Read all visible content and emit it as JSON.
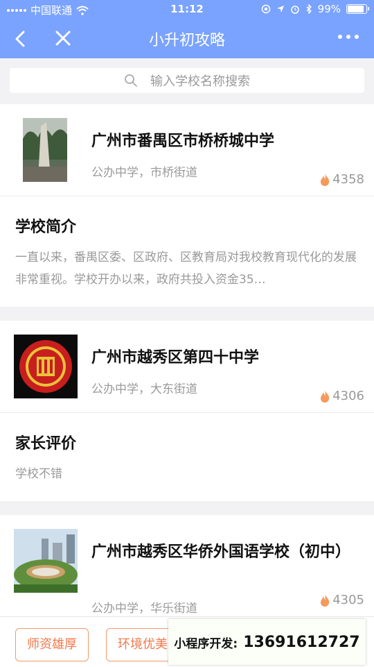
{
  "status": {
    "carrier": "中国联通",
    "time": "11:12",
    "battery": "99%"
  },
  "nav": {
    "title": "小升初攻略"
  },
  "search": {
    "placeholder": "输入学校名称搜索"
  },
  "cards": [
    {
      "name": "广州市番禺区市桥桥城中学",
      "meta": "公办中学，市桥街道",
      "heat": "4358",
      "section_title": "学校简介",
      "section_text": "一直以来，番禺区委、区政府、区教育局对我校教育现代化的发展非常重视。学校开办以来，政府共投入资金35…"
    },
    {
      "name": "广州市越秀区第四十中学",
      "meta": "公办中学，大东街道",
      "heat": "4306",
      "section_title": "家长评价",
      "section_text": "学校不错"
    },
    {
      "name": "广州市越秀区华侨外国语学校（初中）",
      "meta": "公办中学，华乐街道",
      "heat": "4305"
    }
  ],
  "tags": [
    "师资雄厚",
    "环境优美"
  ],
  "overlay": {
    "label": "小程序开发:",
    "phone": "13691612727"
  },
  "colors": {
    "header": "#7aa3ff",
    "tag": "#f2784b",
    "flame": "#f59a5b"
  }
}
